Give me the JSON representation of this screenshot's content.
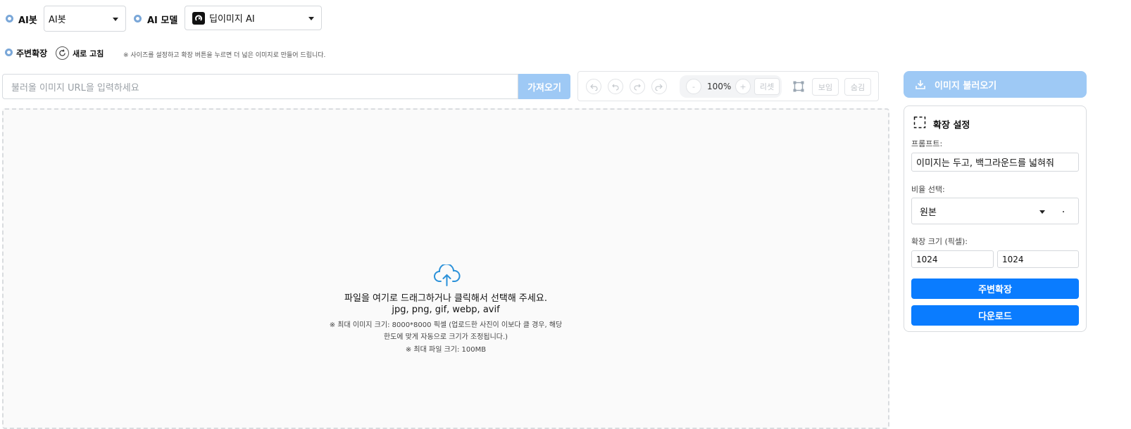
{
  "top": {
    "aibot_label": "AI봇",
    "aibot_select_value": "AI봇",
    "aimodel_label": "AI 모델",
    "aimodel_select_value": "딥이미지 AI"
  },
  "mode": {
    "expand_label": "주변확장",
    "refresh_label": "새로 고침",
    "hint": "※ 사이즈를 설정하고 확장 버튼을 누르면 더 넓은 이미지로 만들어 드립니다."
  },
  "url": {
    "placeholder": "불러올 이미지 URL을 입력하세요",
    "fetch_label": "가져오기"
  },
  "toolbar": {
    "zoom_minus": "-",
    "zoom_value": "100%",
    "zoom_plus": "+",
    "reset_label": "리셋",
    "show_label": "보임",
    "hide_label": "숨김"
  },
  "dropzone": {
    "line1": "파일을 여기로 드래그하거나 클릭해서 선택해 주세요.",
    "line2": "jpg, png, gif, webp, avif",
    "line3": "※ 최대 이미지 크기: 8000*8000 픽셀 (업로드한 사진이 이보다 클 경우, 해당",
    "line4": "한도에 맞게 자동으로 크기가 조정됩니다.)",
    "line5": "※ 최대 파일 크기: 100MB"
  },
  "load_button": "이미지 불러오기",
  "settings": {
    "title": "확장 설정",
    "prompt_label": "프롬프트:",
    "prompt_value": "이미지는 두고, 백그라운드를 넓혀줘",
    "ratio_label": "비율 선택:",
    "ratio_value": "원본",
    "size_label": "확장 크기 (픽셀):",
    "width_value": "1024",
    "height_value": "1024",
    "expand_button": "주변확장",
    "download_button": "다운로드"
  },
  "colors": {
    "accent": "#0a7cff",
    "accent_light": "#9ec9f5",
    "radio": "#7aa7d8"
  }
}
